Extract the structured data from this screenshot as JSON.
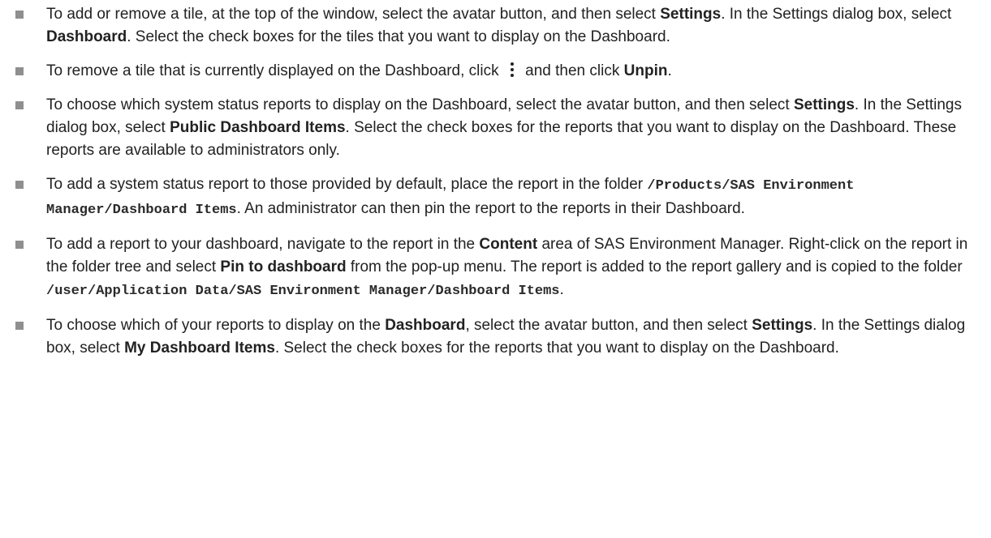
{
  "items": [
    {
      "segments": [
        {
          "t": "To add or remove a tile, at the top of the window, select the avatar button, and then select "
        },
        {
          "t": "Settings",
          "s": "b"
        },
        {
          "t": ". In the Settings dialog box, select "
        },
        {
          "t": "Dashboard",
          "s": "b"
        },
        {
          "t": ". Select the check boxes for the tiles that you want to display on the Dashboard."
        }
      ]
    },
    {
      "segments": [
        {
          "t": "To remove a tile that is currently displayed on the Dashboard, click "
        },
        {
          "icon": "more-vertical-icon"
        },
        {
          "t": " and then click "
        },
        {
          "t": "Unpin",
          "s": "b"
        },
        {
          "t": "."
        }
      ]
    },
    {
      "segments": [
        {
          "t": "To choose which system status reports to display on the Dashboard, select the avatar button, and then select "
        },
        {
          "t": "Settings",
          "s": "b"
        },
        {
          "t": ". In the Settings dialog box, select "
        },
        {
          "t": "Public Dashboard Items",
          "s": "b"
        },
        {
          "t": ". Select the check boxes for the reports that you want to display on the Dashboard. These reports are available to administrators only."
        }
      ]
    },
    {
      "segments": [
        {
          "t": "To add a system status report to those provided by default, place the report in the folder "
        },
        {
          "t": "/Products/SAS Environment Manager/Dashboard Items",
          "s": "code"
        },
        {
          "t": ". An administrator can then pin the report to the reports in their Dashboard."
        }
      ]
    },
    {
      "segments": [
        {
          "t": "To add a report to your dashboard, navigate to the report in the "
        },
        {
          "t": "Content",
          "s": "b"
        },
        {
          "t": " area of SAS Environment Manager. Right-click on the report in the folder tree and select "
        },
        {
          "t": "Pin to dashboard",
          "s": "b"
        },
        {
          "t": " from the pop-up menu. The report is added to the report gallery and is copied to the folder "
        },
        {
          "t": "/user/Application Data/SAS Environment Manager/Dashboard Items",
          "s": "code"
        },
        {
          "t": "."
        }
      ]
    },
    {
      "segments": [
        {
          "t": "To choose which of your reports to display on the "
        },
        {
          "t": "Dashboard",
          "s": "b"
        },
        {
          "t": ", select the avatar button, and then select "
        },
        {
          "t": "Settings",
          "s": "b"
        },
        {
          "t": ". In the Settings dialog box, select "
        },
        {
          "t": "My Dashboard Items",
          "s": "b"
        },
        {
          "t": ". Select the check boxes for the reports that you want to display on the Dashboard."
        }
      ]
    }
  ]
}
